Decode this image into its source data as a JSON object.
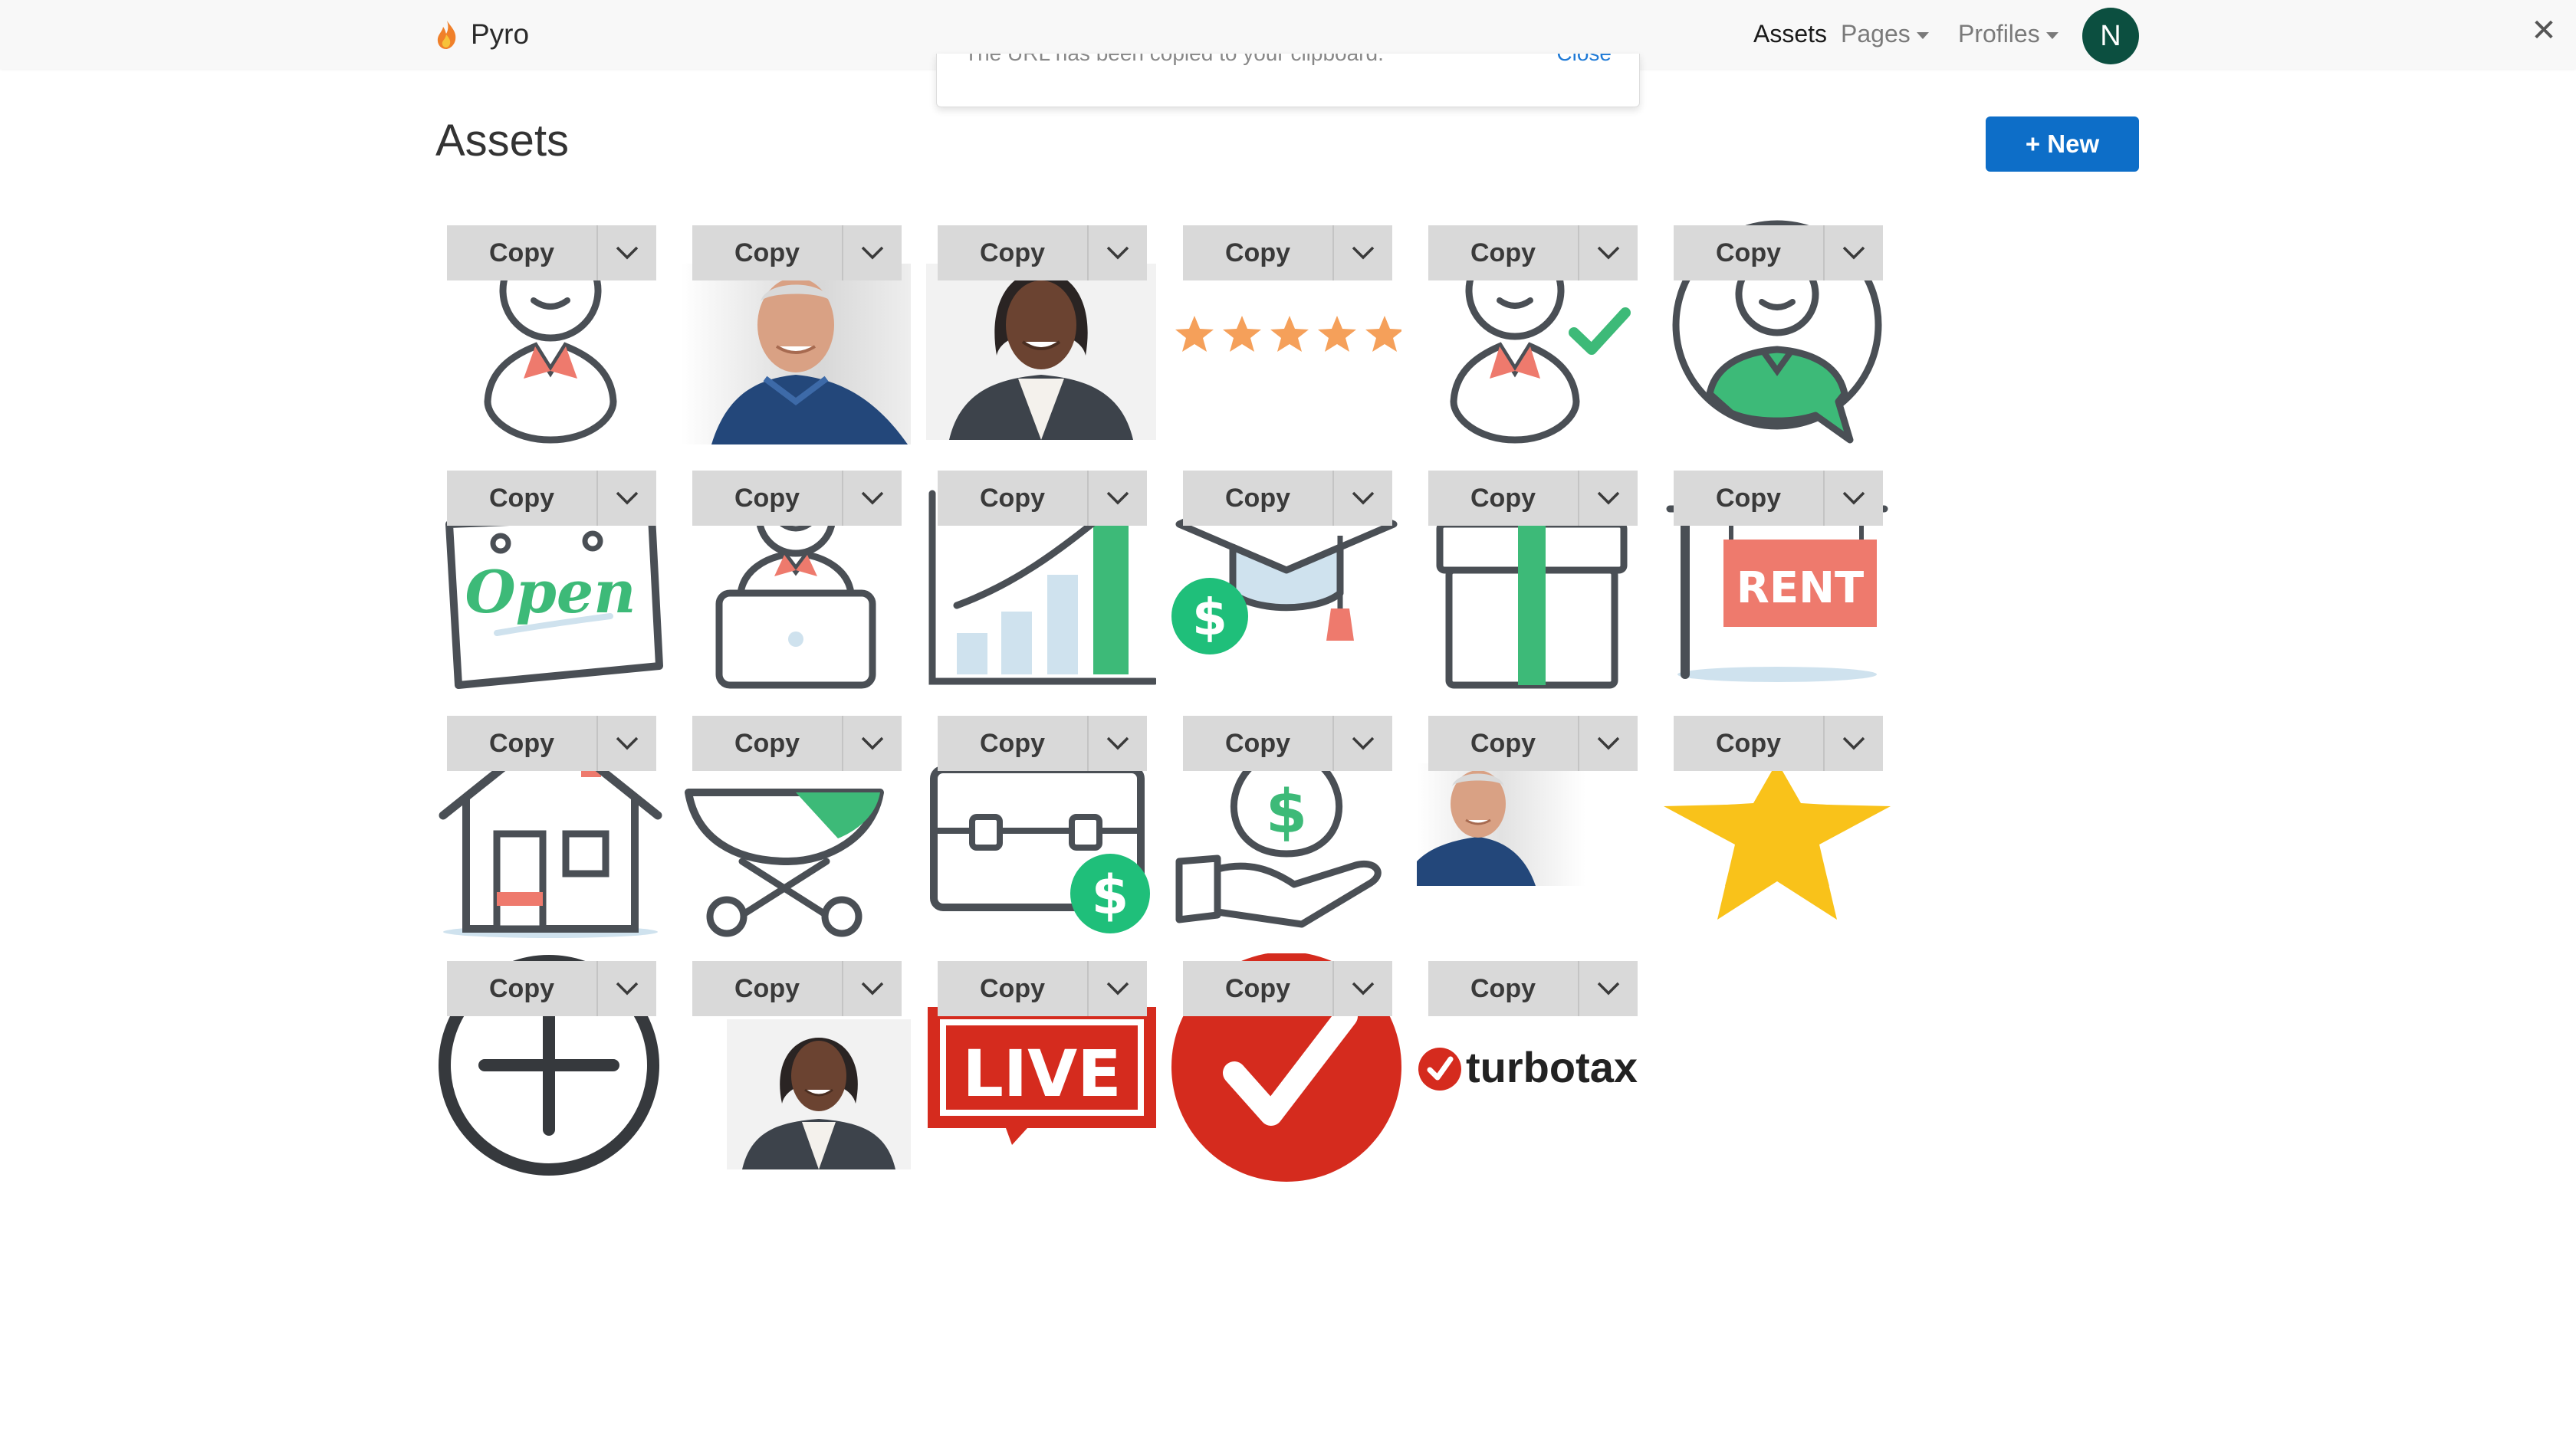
{
  "navbar": {
    "brand": "Pyro",
    "links": [
      {
        "label": "Assets"
      },
      {
        "label": "Pages"
      },
      {
        "label": "Profiles"
      }
    ],
    "avatar_initial": "N",
    "close_glyph": "✕"
  },
  "toast": {
    "message": "The URL has been copied to your clipboard.",
    "close_label": "Close"
  },
  "page": {
    "title": "Assets",
    "new_button": "+ New"
  },
  "asset_actions": {
    "copy_label": "Copy"
  },
  "assets": [
    {
      "icon": "person-outline-icon"
    },
    {
      "icon": "man-photo"
    },
    {
      "icon": "woman-photo"
    },
    {
      "icon": "five-stars-icon"
    },
    {
      "icon": "person-checkmark-icon"
    },
    {
      "icon": "person-circle-chat-icon"
    },
    {
      "icon": "open-sign-icon"
    },
    {
      "icon": "person-laptop-icon"
    },
    {
      "icon": "growth-bar-chart-icon"
    },
    {
      "icon": "graduation-cap-dollar-icon"
    },
    {
      "icon": "gift-box-icon"
    },
    {
      "icon": "rent-sign-icon"
    },
    {
      "icon": "house-icon"
    },
    {
      "icon": "stroller-icon"
    },
    {
      "icon": "briefcase-dollar-icon"
    },
    {
      "icon": "hand-money-bag-icon"
    },
    {
      "icon": "man-photo-small"
    },
    {
      "icon": "gold-star-icon"
    },
    {
      "icon": "plus-circle-icon"
    },
    {
      "icon": "woman-photo-small"
    },
    {
      "icon": "live-badge-icon"
    },
    {
      "icon": "red-checkmark-circle-icon"
    },
    {
      "icon": "turbotax-logo",
      "logo_text": "turbotax"
    }
  ],
  "colors": {
    "primary": "#0d6ec8",
    "avatar": "#0c4f40",
    "icon_stroke": "#4a4f55",
    "accent_green": "#3dba78",
    "accent_coral": "#ee7a6d",
    "star_orange": "#f5a05a",
    "star_gold": "#f9c21a",
    "brand_red": "#d52b1e"
  }
}
